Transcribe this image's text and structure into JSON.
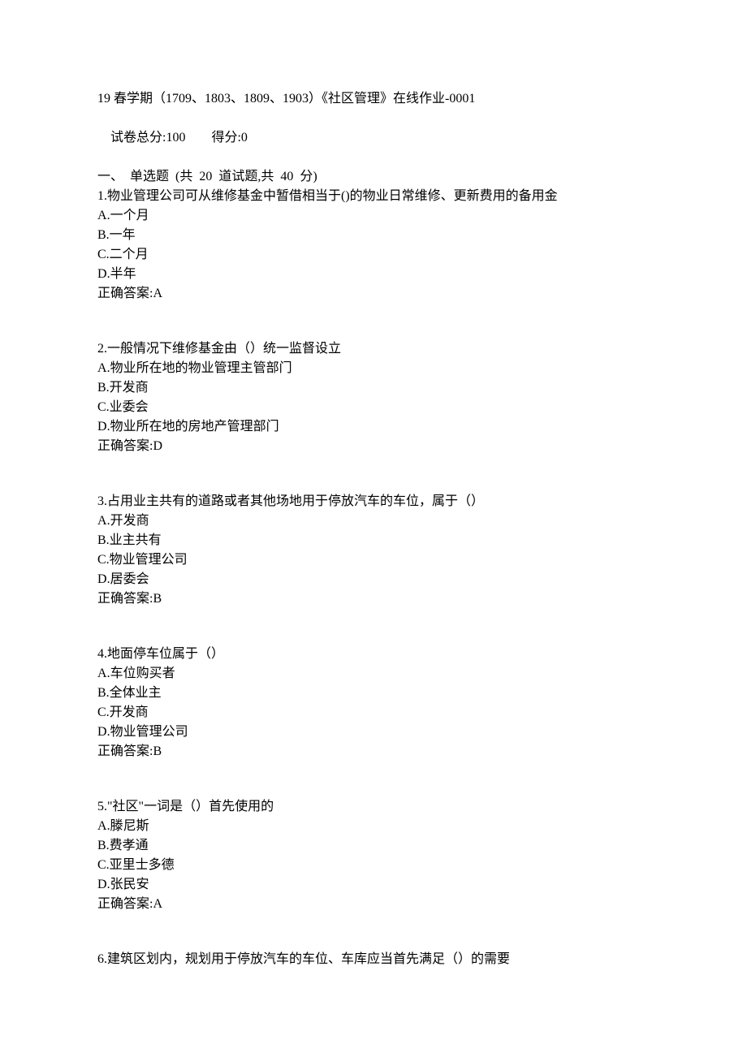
{
  "header": {
    "title": "19 春学期（1709、1803、1809、1903）《社区管理》在线作业-0001",
    "total_score_label": "试卷总分:100",
    "obtained_score_label": "得分:0",
    "section_label": "一、  单选题  (共  20  道试题,共  40  分)"
  },
  "questions": [
    {
      "number": "1",
      "text": "物业管理公司可从维修基金中暂借相当于()的物业日常维修、更新费用的备用金",
      "options": [
        {
          "label": "A",
          "text": "一个月"
        },
        {
          "label": "B",
          "text": "一年"
        },
        {
          "label": "C",
          "text": "二个月"
        },
        {
          "label": "D",
          "text": "半年"
        }
      ],
      "answer_label": "正确答案:",
      "answer": "A"
    },
    {
      "number": "2",
      "text": "一般情况下维修基金由（）统一监督设立",
      "options": [
        {
          "label": "A",
          "text": "物业所在地的物业管理主管部门"
        },
        {
          "label": "B",
          "text": "开发商"
        },
        {
          "label": "C",
          "text": "业委会"
        },
        {
          "label": "D",
          "text": "物业所在地的房地产管理部门"
        }
      ],
      "answer_label": "正确答案:",
      "answer": "D"
    },
    {
      "number": "3",
      "text": "占用业主共有的道路或者其他场地用于停放汽车的车位，属于（）",
      "options": [
        {
          "label": "A",
          "text": "开发商"
        },
        {
          "label": "B",
          "text": "业主共有"
        },
        {
          "label": "C",
          "text": "物业管理公司"
        },
        {
          "label": "D",
          "text": "居委会"
        }
      ],
      "answer_label": "正确答案:",
      "answer": "B"
    },
    {
      "number": "4",
      "text": "地面停车位属于（）",
      "options": [
        {
          "label": "A",
          "text": "车位购买者"
        },
        {
          "label": "B",
          "text": "全体业主"
        },
        {
          "label": "C",
          "text": "开发商"
        },
        {
          "label": "D",
          "text": "物业管理公司"
        }
      ],
      "answer_label": "正确答案:",
      "answer": "B"
    },
    {
      "number": "5",
      "text": "\"社区\"一词是（）首先使用的",
      "options": [
        {
          "label": "A",
          "text": "滕尼斯"
        },
        {
          "label": "B",
          "text": "费孝通"
        },
        {
          "label": "C",
          "text": "亚里士多德"
        },
        {
          "label": "D",
          "text": "张民安"
        }
      ],
      "answer_label": "正确答案:",
      "answer": "A"
    },
    {
      "number": "6",
      "text": "建筑区划内，规划用于停放汽车的车位、车库应当首先满足（）的需要",
      "options": [],
      "answer_label": "",
      "answer": ""
    }
  ]
}
